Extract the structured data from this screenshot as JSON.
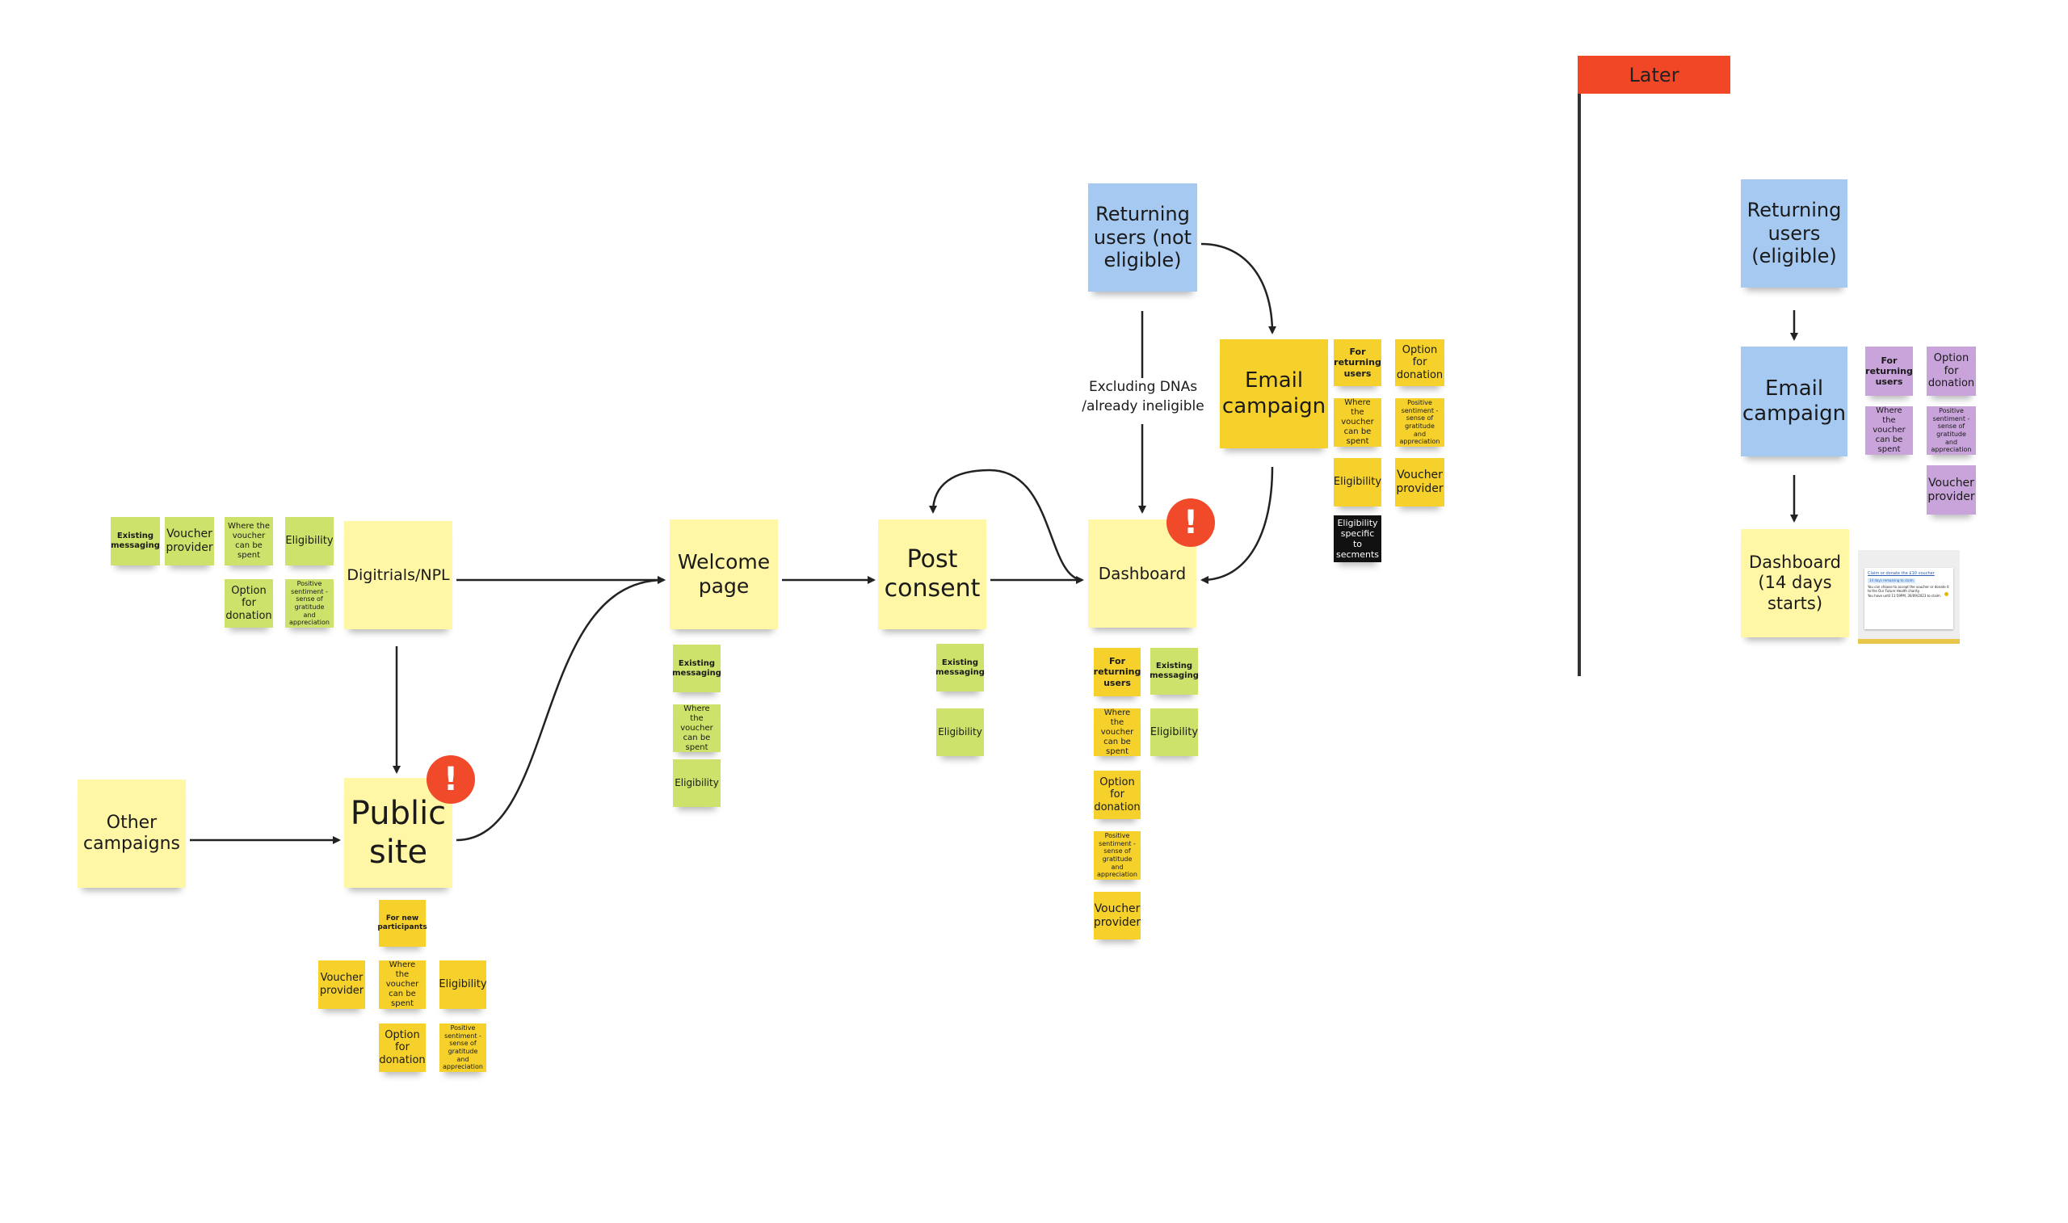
{
  "colors": {
    "pale": "#fff7a6",
    "blue": "#a5c9f0",
    "yellow": "#f6d12c",
    "green": "#cde26a",
    "purple": "#c8a4da",
    "black": "#111111",
    "red": "#f24726"
  },
  "later_label": "Later",
  "edge_label": "Excluding DNAs\n/already ineligible",
  "notes": [
    {
      "id": "returning-not-eligible",
      "text": "Returning users (not eligible)",
      "color": "blue"
    },
    {
      "id": "email-campaign",
      "text": "Email campaign",
      "color": "yellow"
    },
    {
      "id": "ec-for-returning",
      "text": "For returning users",
      "color": "yellow"
    },
    {
      "id": "ec-option",
      "text": "Option for donation",
      "color": "yellow"
    },
    {
      "id": "ec-where",
      "text": "Where the voucher can be spent",
      "color": "yellow"
    },
    {
      "id": "ec-positive",
      "text": "Positive sentiment - sense of gratitude and appreciation",
      "color": "yellow"
    },
    {
      "id": "ec-eligibility",
      "text": "Eligibility",
      "color": "yellow"
    },
    {
      "id": "ec-voucher",
      "text": "Voucher provider",
      "color": "yellow"
    },
    {
      "id": "ec-segments",
      "text": "Eligibility specific to secments",
      "color": "black"
    },
    {
      "id": "digitrials",
      "text": "Digitrials/NPL",
      "color": "pale"
    },
    {
      "id": "dg-existing",
      "text": "Existing messaging",
      "color": "green"
    },
    {
      "id": "dg-voucher",
      "text": "Voucher provider",
      "color": "green"
    },
    {
      "id": "dg-where",
      "text": "Where the voucher can be spent",
      "color": "green"
    },
    {
      "id": "dg-eligibility",
      "text": "Eligibility",
      "color": "green"
    },
    {
      "id": "dg-option",
      "text": "Option for donation",
      "color": "green"
    },
    {
      "id": "dg-positive",
      "text": "Positive sentiment - sense of gratitude and appreciation",
      "color": "green"
    },
    {
      "id": "welcome",
      "text": "Welcome page",
      "color": "pale"
    },
    {
      "id": "wp-existing",
      "text": "Existing messaging",
      "color": "green"
    },
    {
      "id": "wp-where",
      "text": "Where the voucher can be spent",
      "color": "green"
    },
    {
      "id": "wp-eligibility",
      "text": "Eligibility",
      "color": "green"
    },
    {
      "id": "post-consent",
      "text": "Post consent",
      "color": "pale"
    },
    {
      "id": "pc-existing",
      "text": "Existing messaging",
      "color": "green"
    },
    {
      "id": "pc-eligibility",
      "text": "Eligibility",
      "color": "green"
    },
    {
      "id": "dashboard",
      "text": "Dashboard",
      "color": "pale"
    },
    {
      "id": "db-for-returning",
      "text": "For returning users",
      "color": "yellow"
    },
    {
      "id": "db-existing",
      "text": "Existing messaging",
      "color": "green"
    },
    {
      "id": "db-where",
      "text": "Where the voucher can be spent",
      "color": "yellow"
    },
    {
      "id": "db-eligibility",
      "text": "Eligibility",
      "color": "green"
    },
    {
      "id": "db-option",
      "text": "Option for donation",
      "color": "yellow"
    },
    {
      "id": "db-positive",
      "text": "Positive sentiment - sense of gratitude and appreciation",
      "color": "yellow"
    },
    {
      "id": "db-voucher",
      "text": "Voucher provider",
      "color": "yellow"
    },
    {
      "id": "other-campaigns",
      "text": "Other campaigns",
      "color": "pale"
    },
    {
      "id": "public-site",
      "text": "Public site",
      "color": "pale"
    },
    {
      "id": "ps-new",
      "text": "For new participants",
      "color": "yellow"
    },
    {
      "id": "ps-voucher",
      "text": "Voucher provider",
      "color": "yellow"
    },
    {
      "id": "ps-where",
      "text": "Where the voucher can be spent",
      "color": "yellow"
    },
    {
      "id": "ps-eligibility",
      "text": "Eligibility",
      "color": "yellow"
    },
    {
      "id": "ps-option",
      "text": "Option for donation",
      "color": "yellow"
    },
    {
      "id": "ps-positive",
      "text": "Positive sentiment - sense of gratitude and appreciation",
      "color": "yellow"
    },
    {
      "id": "returning-eligible",
      "text": "Returning users (eligible)",
      "color": "blue"
    },
    {
      "id": "later-email",
      "text": "Email campaign",
      "color": "blue"
    },
    {
      "id": "le-for-returning",
      "text": "For returning users",
      "color": "purple"
    },
    {
      "id": "le-option",
      "text": "Option for donation",
      "color": "purple"
    },
    {
      "id": "le-where",
      "text": "Where the voucher can be spent",
      "color": "purple"
    },
    {
      "id": "le-positive",
      "text": "Positive sentiment - sense of gratitude and appreciation",
      "color": "purple"
    },
    {
      "id": "le-voucher",
      "text": "Voucher provider",
      "color": "purple"
    },
    {
      "id": "later-dashboard",
      "text": "Dashboard (14 days starts)",
      "color": "pale"
    }
  ],
  "warnings": [
    {
      "id": "dashboard-warning",
      "icon": "exclamation-icon",
      "text": "!"
    },
    {
      "id": "public-site-warning",
      "icon": "exclamation-icon",
      "text": "!"
    }
  ],
  "card": {
    "title": "Claim or donate the £10 voucher",
    "badge": "14 days remaining to claim",
    "body": "You can choose to accept the voucher or donate it to the Our Future Health charity.",
    "footer": "You have until 11:59PM, 30/09/2023 to claim."
  }
}
